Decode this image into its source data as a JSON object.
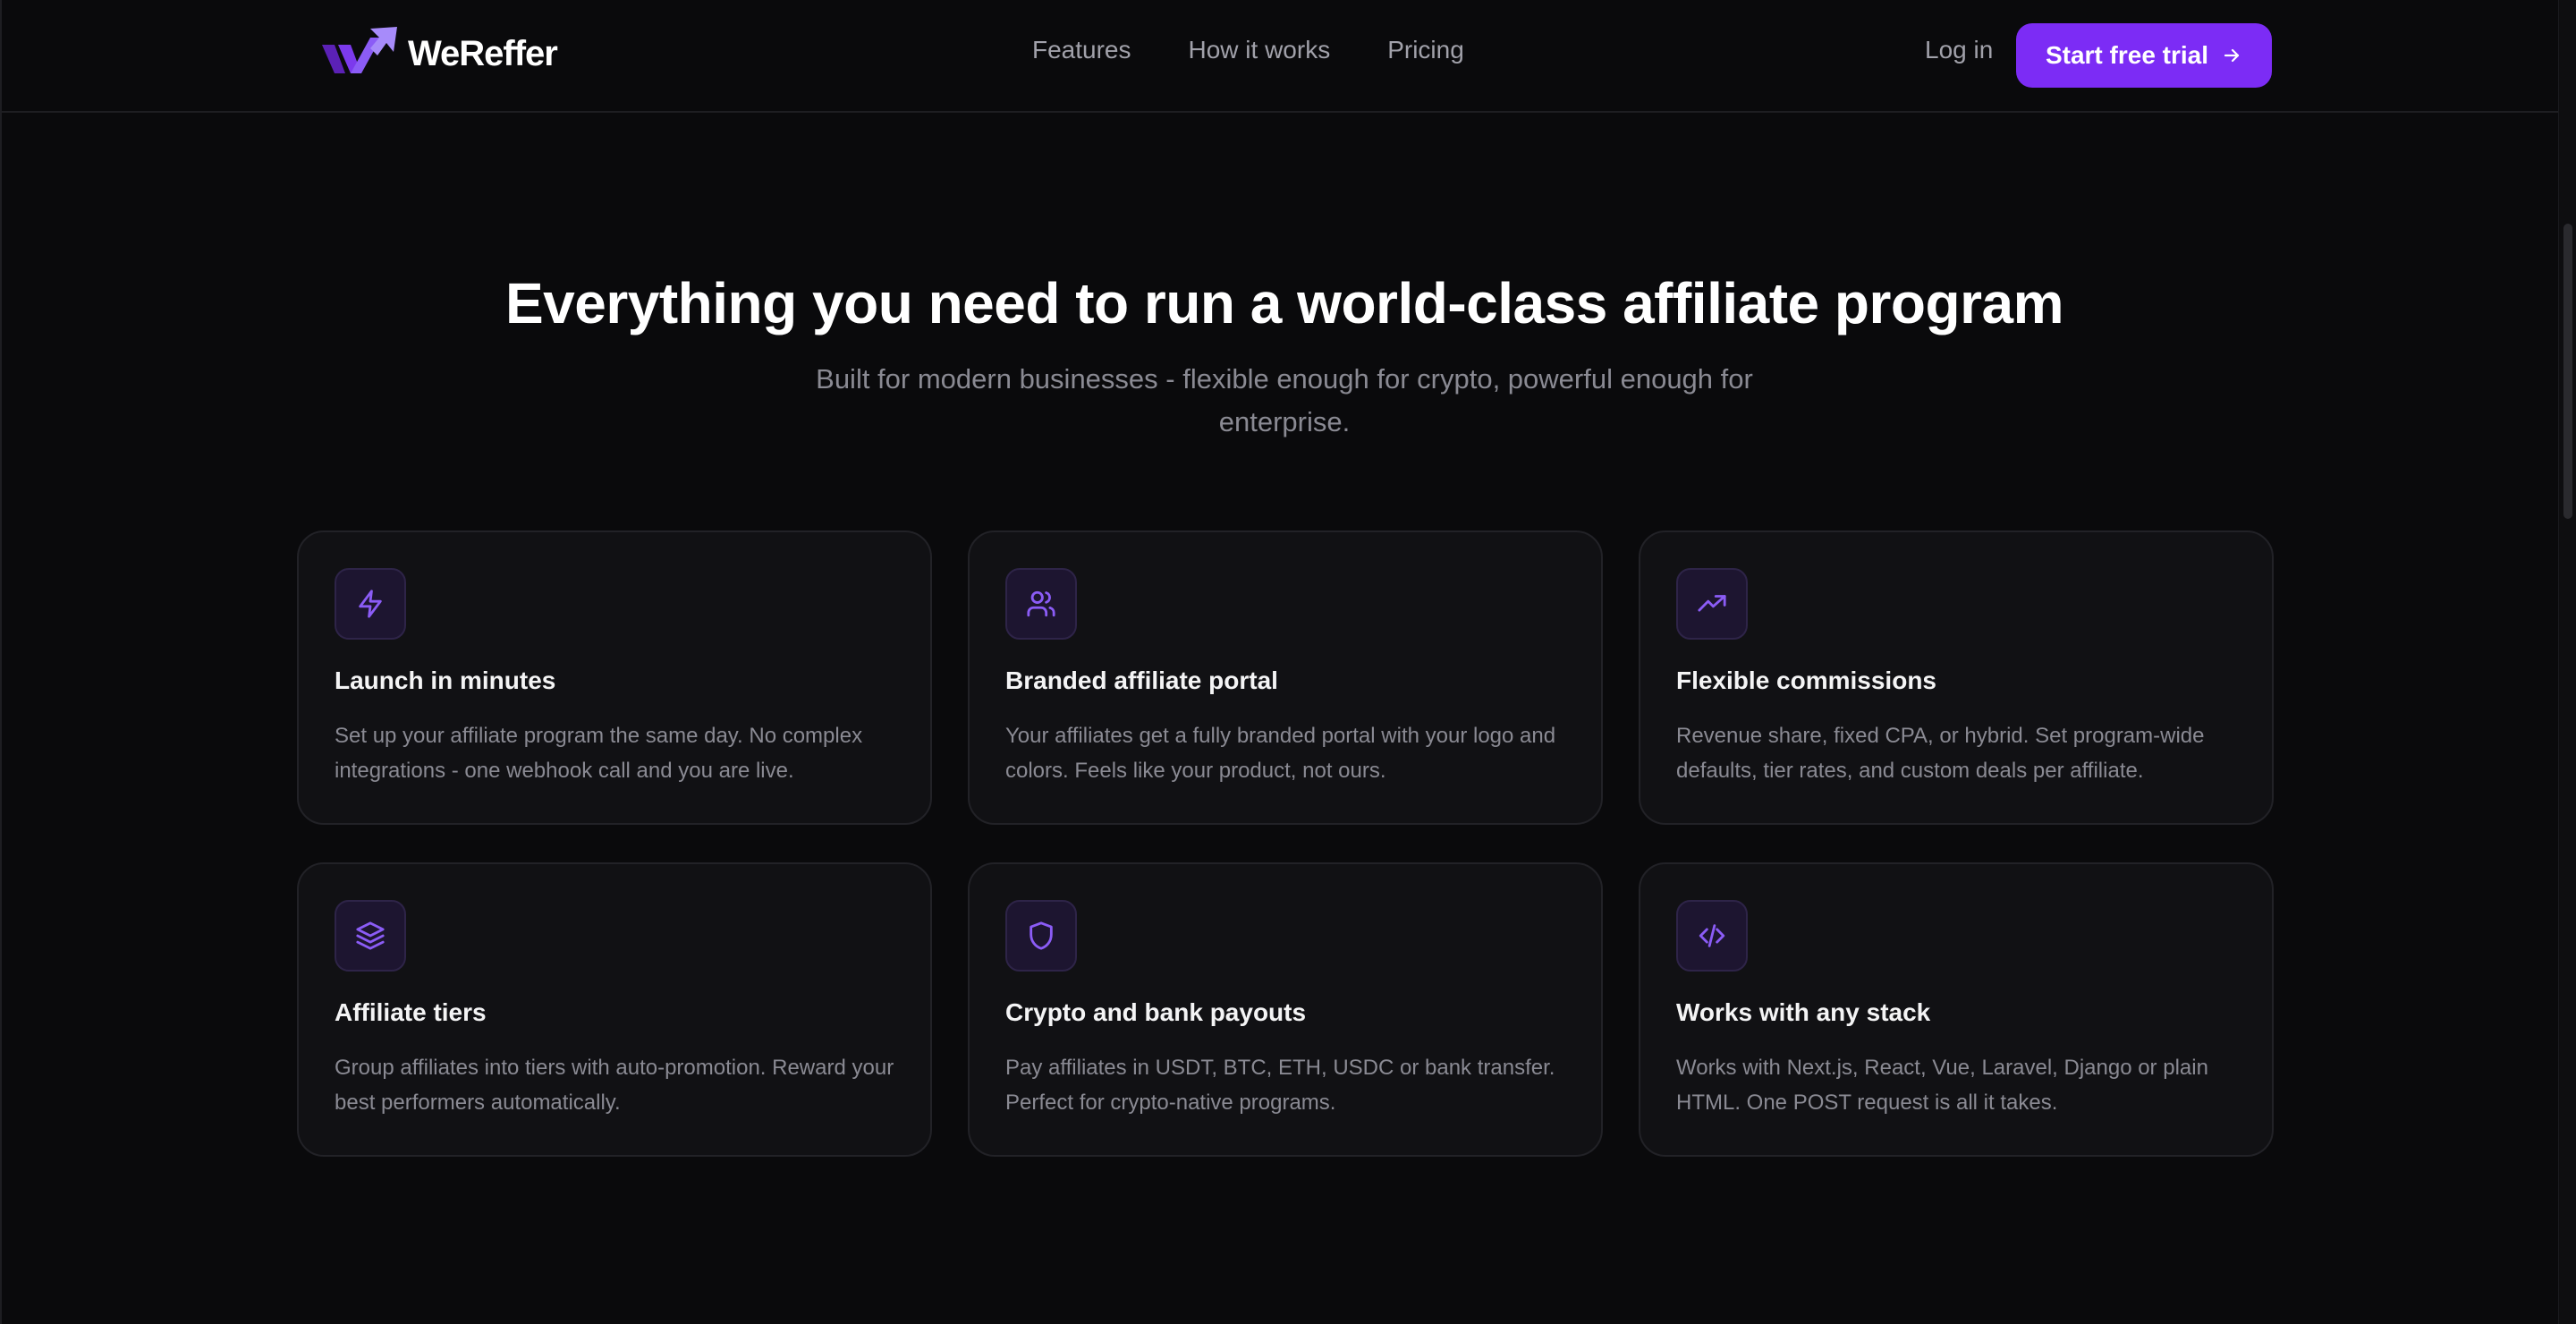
{
  "brand": {
    "name": "WeReffer",
    "accent": "#7c2cf5",
    "icon_accent": "#8b5cf6"
  },
  "nav": {
    "items": [
      {
        "label": "Features"
      },
      {
        "label": "How it works"
      },
      {
        "label": "Pricing"
      }
    ],
    "login_label": "Log in",
    "cta_label": "Start free trial"
  },
  "hero": {
    "title": "Everything you need to run a world-class affiliate program",
    "subtitle": "Built for modern businesses - flexible enough for crypto, powerful enough for enterprise."
  },
  "features": [
    {
      "icon": "lightning-icon",
      "title": "Launch in minutes",
      "description": "Set up your affiliate program the same day. No complex integrations - one webhook call and you are live."
    },
    {
      "icon": "users-icon",
      "title": "Branded affiliate portal",
      "description": "Your affiliates get a fully branded portal with your logo and colors. Feels like your product, not ours."
    },
    {
      "icon": "trending-up-icon",
      "title": "Flexible commissions",
      "description": "Revenue share, fixed CPA, or hybrid. Set program-wide defaults, tier rates, and custom deals per affiliate."
    },
    {
      "icon": "layers-icon",
      "title": "Affiliate tiers",
      "description": "Group affiliates into tiers with auto-promotion. Reward your best performers automatically."
    },
    {
      "icon": "shield-icon",
      "title": "Crypto and bank payouts",
      "description": "Pay affiliates in USDT, BTC, ETH, USDC or bank transfer. Perfect for crypto-native programs."
    },
    {
      "icon": "code-icon",
      "title": "Works with any stack",
      "description": "Works with Next.js, React, Vue, Laravel, Django or plain HTML. One POST request is all it takes."
    }
  ]
}
